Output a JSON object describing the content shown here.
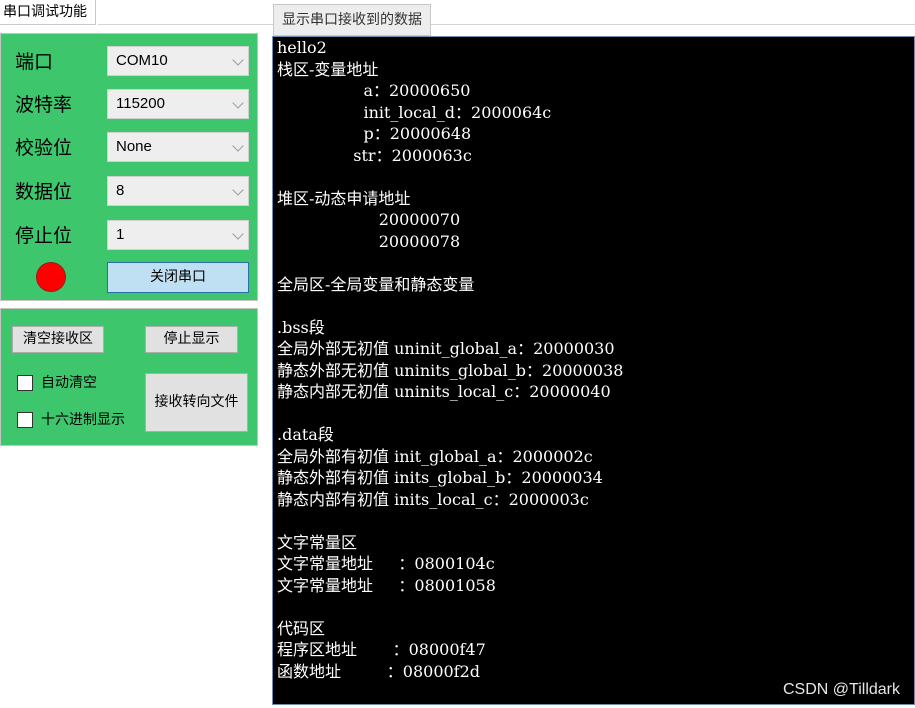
{
  "tabs": {
    "main_tab": "串口调试功能"
  },
  "receive_group": {
    "label": "显示串口接收到的数据"
  },
  "settings": {
    "port": {
      "label": "端口",
      "value": "COM10"
    },
    "baud": {
      "label": "波特率",
      "value": "115200"
    },
    "parity": {
      "label": "校验位",
      "value": "None"
    },
    "data_bits": {
      "label": "数据位",
      "value": "8"
    },
    "stop_bits": {
      "label": "停止位",
      "value": "1"
    },
    "status_color": "#ff0000",
    "close_port_label": "关闭串口"
  },
  "receive_controls": {
    "clear_label": "清空接收区",
    "stop_display_label": "停止显示",
    "auto_clear_label": "自动清空",
    "auto_clear_checked": false,
    "hex_display_label": "十六进制显示",
    "hex_display_checked": false,
    "redirect_file_label": "接收转向文件"
  },
  "console": {
    "lines": [
      "hello2",
      "栈区-变量地址",
      "                 a：20000650",
      "                 init_local_d：2000064c",
      "                 p：20000648",
      "               str：2000063c",
      "",
      "堆区-动态申请地址",
      "                    20000070",
      "                    20000078",
      "",
      "全局区-全局变量和静态变量",
      "",
      ".bss段",
      "全局外部无初值 uninit_global_a：20000030",
      "静态外部无初值 uninits_global_b：20000038",
      "静态内部无初值 uninits_local_c：20000040",
      "",
      ".data段",
      "全局外部有初值 init_global_a：2000002c",
      "静态外部有初值 inits_global_b：20000034",
      "静态内部有初值 inits_local_c：2000003c",
      "",
      "文字常量区",
      "文字常量地址     ：0800104c",
      "文字常量地址     ：08001058",
      "",
      "代码区",
      "程序区地址       ：08000f47",
      "函数地址         ：08000f2d"
    ]
  },
  "watermark": "CSDN @Tilldark"
}
